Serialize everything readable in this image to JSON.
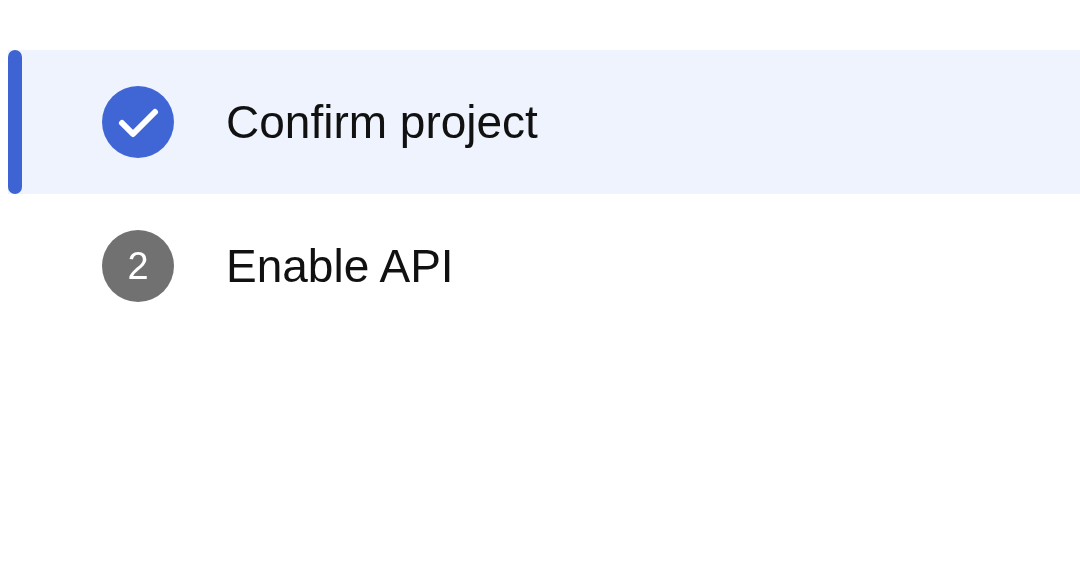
{
  "steps": [
    {
      "kind": "done",
      "label": "Confirm project",
      "selected": true
    },
    {
      "kind": "pending",
      "number": "2",
      "label": "Enable API",
      "selected": false
    }
  ]
}
